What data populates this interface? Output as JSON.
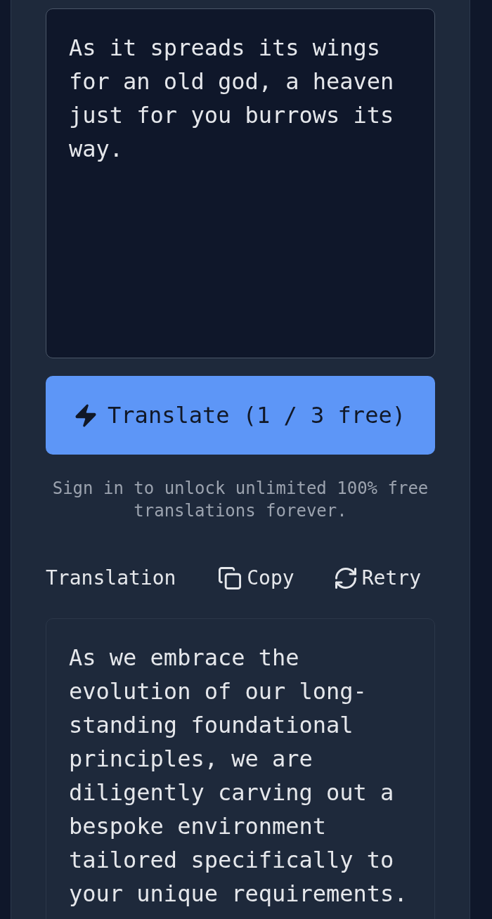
{
  "source": {
    "value": "As it spreads its wings for an old god, a heaven just for you burrows its way."
  },
  "translate_button": {
    "label": "Translate (1 / 3 free)"
  },
  "sign_in_hint": "Sign in to unlock unlimited 100% free translations forever.",
  "translation": {
    "heading": "Translation",
    "actions": [
      {
        "kind": "copy",
        "label": "Copy"
      },
      {
        "kind": "retry",
        "label": "Retry"
      }
    ],
    "text": "As we embrace the evolution of our long-standing foundational principles, we are diligently carving out a bespoke environment tailored specifically to your unique requirements."
  }
}
